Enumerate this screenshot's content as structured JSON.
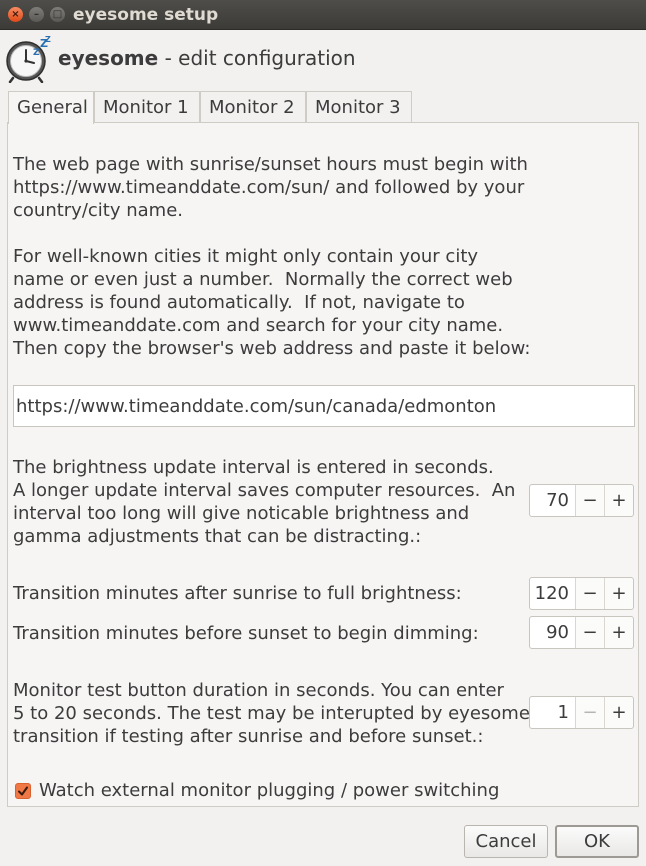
{
  "window": {
    "title": "eyesome setup",
    "close_glyph": "×",
    "minimize_glyph": "–",
    "maximize_glyph": "□"
  },
  "header": {
    "app_name": "eyesome",
    "subtitle": " - edit configuration",
    "icon": "alarm-clock-zzz-icon"
  },
  "tabs": [
    {
      "label": "General",
      "active": true
    },
    {
      "label": "Monitor 1",
      "active": false
    },
    {
      "label": "Monitor 2",
      "active": false
    },
    {
      "label": "Monitor 3",
      "active": false
    }
  ],
  "general": {
    "intro_text": "The web page with sunrise/sunset hours must begin with\nhttps://www.timeanddate.com/sun/ and followed by your\ncountry/city name.",
    "help_text": "For well-known cities it might only contain your city\nname or even just a number.  Normally the correct web\naddress is found automatically.  If not, navigate to\nwww.timeanddate.com and search for your city name.\nThen copy the browser's web address and paste it below:",
    "url_value": "https://www.timeanddate.com/sun/canada/edmonton",
    "interval_text": "The brightness update interval is entered in seconds.\nA longer update interval saves computer resources.  An\ninterval too long will give noticable brightness and\ngamma adjustments that can be distracting.:",
    "interval_value": "70",
    "sunrise_text": "Transition minutes after sunrise to full brightness:",
    "sunrise_value": "120",
    "sunset_text": "Transition minutes before sunset to begin dimming:",
    "sunset_value": "90",
    "test_text": "Monitor test button duration in seconds. You can enter\n5 to 20 seconds. The test may be interupted by eyesome\ntransition if testing after sunrise and before sunset.:",
    "test_value": "1",
    "watch_label": "Watch external monitor plugging / power switching",
    "watch_checked": true,
    "minus": "−",
    "plus": "+"
  },
  "buttons": {
    "cancel": "Cancel",
    "ok": "OK"
  },
  "colors": {
    "accent": "#f07746",
    "titlebar": "#3c3b37"
  }
}
